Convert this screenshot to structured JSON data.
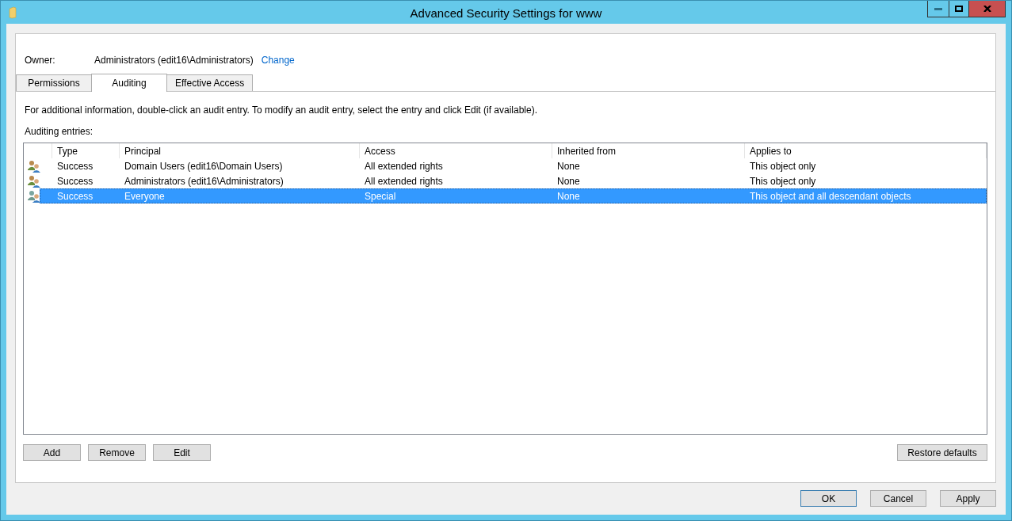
{
  "window": {
    "title": "Advanced Security Settings for www"
  },
  "owner": {
    "label": "Owner:",
    "value": "Administrators (edit16\\Administrators)",
    "change_link": "Change"
  },
  "tabs": [
    {
      "label": "Permissions",
      "selected": false
    },
    {
      "label": "Auditing",
      "selected": true
    },
    {
      "label": "Effective Access",
      "selected": false
    }
  ],
  "info_text": "For additional information, double-click an audit entry. To modify an audit entry, select the entry and click Edit (if available).",
  "entries_label": "Auditing entries:",
  "table": {
    "columns": [
      "Type",
      "Principal",
      "Access",
      "Inherited from",
      "Applies to"
    ],
    "rows": [
      {
        "selected": false,
        "cells": [
          "Success",
          "Domain Users (edit16\\Domain Users)",
          "All extended rights",
          "None",
          "This object only"
        ]
      },
      {
        "selected": false,
        "cells": [
          "Success",
          "Administrators (edit16\\Administrators)",
          "All extended rights",
          "None",
          "This object only"
        ]
      },
      {
        "selected": true,
        "cells": [
          "Success",
          "Everyone",
          "Special",
          "None",
          "This object and all descendant objects"
        ]
      }
    ]
  },
  "entry_buttons": [
    "Add",
    "Remove",
    "Edit"
  ],
  "restore_button": "Restore defaults",
  "dialog_buttons": [
    {
      "label": "OK",
      "default": true
    },
    {
      "label": "Cancel",
      "default": false
    },
    {
      "label": "Apply",
      "default": false
    }
  ]
}
